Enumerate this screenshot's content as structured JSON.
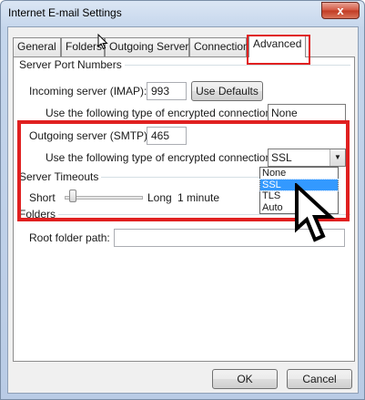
{
  "window": {
    "title": "Internet E-mail Settings",
    "close_label": "x"
  },
  "tabs": [
    {
      "label": "General"
    },
    {
      "label": "Folders"
    },
    {
      "label": "Outgoing Server"
    },
    {
      "label": "Connection"
    },
    {
      "label": "Advanced"
    }
  ],
  "active_tab": "Advanced",
  "server_ports": {
    "group_label": "Server Port Numbers",
    "incoming_label": "Incoming server (IMAP):",
    "incoming_value": "993",
    "use_defaults_label": "Use Defaults",
    "incoming_encryption_label": "Use the following type of encrypted connection:",
    "incoming_encryption_value": "None",
    "outgoing_label": "Outgoing server (SMTP):",
    "outgoing_value": "465",
    "outgoing_encryption_label": "Use the following type of encrypted connection:",
    "outgoing_encryption_value": "SSL",
    "encryption_options": [
      "None",
      "SSL",
      "TLS",
      "Auto"
    ]
  },
  "server_timeouts": {
    "group_label": "Server Timeouts",
    "short_label": "Short",
    "long_label": "Long",
    "value_text": "1 minute",
    "slider_level": 0.05
  },
  "folders": {
    "group_label": "Folders",
    "root_label": "Root folder path:",
    "root_value": ""
  },
  "footer": {
    "ok_label": "OK",
    "cancel_label": "Cancel"
  },
  "colors": {
    "highlight_red": "#e02020",
    "selection_blue": "#3399ff"
  }
}
